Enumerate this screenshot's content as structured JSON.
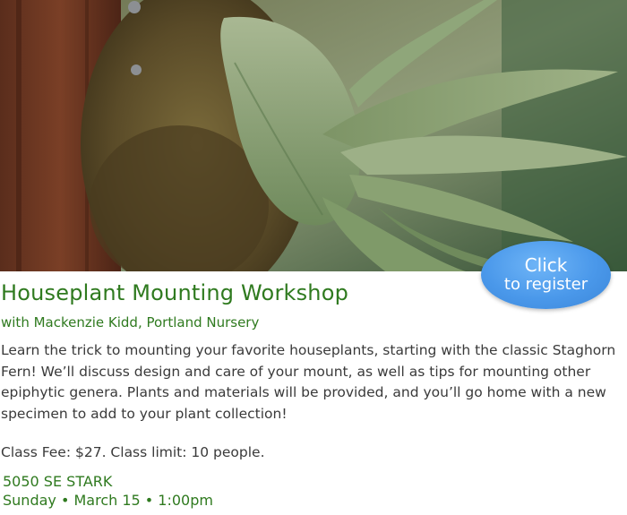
{
  "hero": {
    "image_subject": "staghorn-fern-mounted-on-moss-board"
  },
  "register_button": {
    "line1": "Click",
    "line2": "to register",
    "color": "#4a98ea"
  },
  "event": {
    "title": "Houseplant Mounting Workshop",
    "subtitle": "with Mackenzie Kidd, Portland Nursery",
    "description": "Learn the trick to mounting your favorite houseplants, starting with the classic Staghorn Fern! We’ll discuss design and care of your mount, as well as tips for mounting other epiphytic genera. Plants and materials will be provided, and you’ll go home with a new specimen to add to your plant collection!",
    "fee": "Class Fee: $27. Class limit: 10 people.",
    "address": "5050 SE STARK",
    "datetime": "Sunday • March 15 • 1:00pm"
  },
  "colors": {
    "accent_green": "#2f7a1f",
    "body_text": "#3a3a3a"
  }
}
